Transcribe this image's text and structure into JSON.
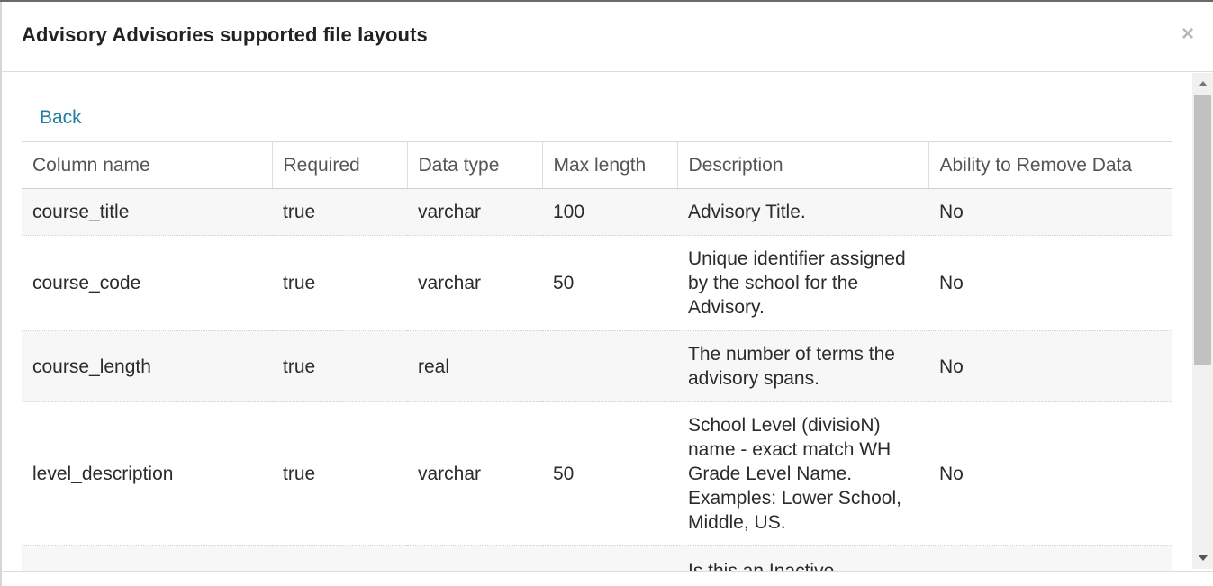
{
  "modal": {
    "title": "Advisory Advisories supported file layouts",
    "close_icon": "×"
  },
  "body": {
    "back_label": "Back"
  },
  "table": {
    "headers": [
      "Column name",
      "Required",
      "Data type",
      "Max length",
      "Description",
      "Ability to Remove Data"
    ],
    "rows": [
      {
        "column_name": "course_title",
        "required": "true",
        "data_type": "varchar",
        "max_length": "100",
        "description": "Advisory Title.",
        "remove": "No"
      },
      {
        "column_name": "course_code",
        "required": "true",
        "data_type": "varchar",
        "max_length": "50",
        "description": "Unique identifier assigned by the school for the Advisory.",
        "remove": "No"
      },
      {
        "column_name": "course_length",
        "required": "true",
        "data_type": "real",
        "max_length": "",
        "description": "The number of terms the advisory spans.",
        "remove": "No"
      },
      {
        "column_name": "level_description",
        "required": "true",
        "data_type": "varchar",
        "max_length": "50",
        "description": "School Level (divisioN) name - exact match WH Grade Level Name. Examples: Lower School, Middle, US.",
        "remove": "No"
      },
      {
        "column_name": "",
        "required": "",
        "data_type": "",
        "max_length": "",
        "description": "Is this an Inactive",
        "remove": ""
      }
    ]
  },
  "colors": {
    "link": "#1f7fa0",
    "row_stripe": "#f7f7f7",
    "scroll_thumb": "#c1c1c1"
  }
}
